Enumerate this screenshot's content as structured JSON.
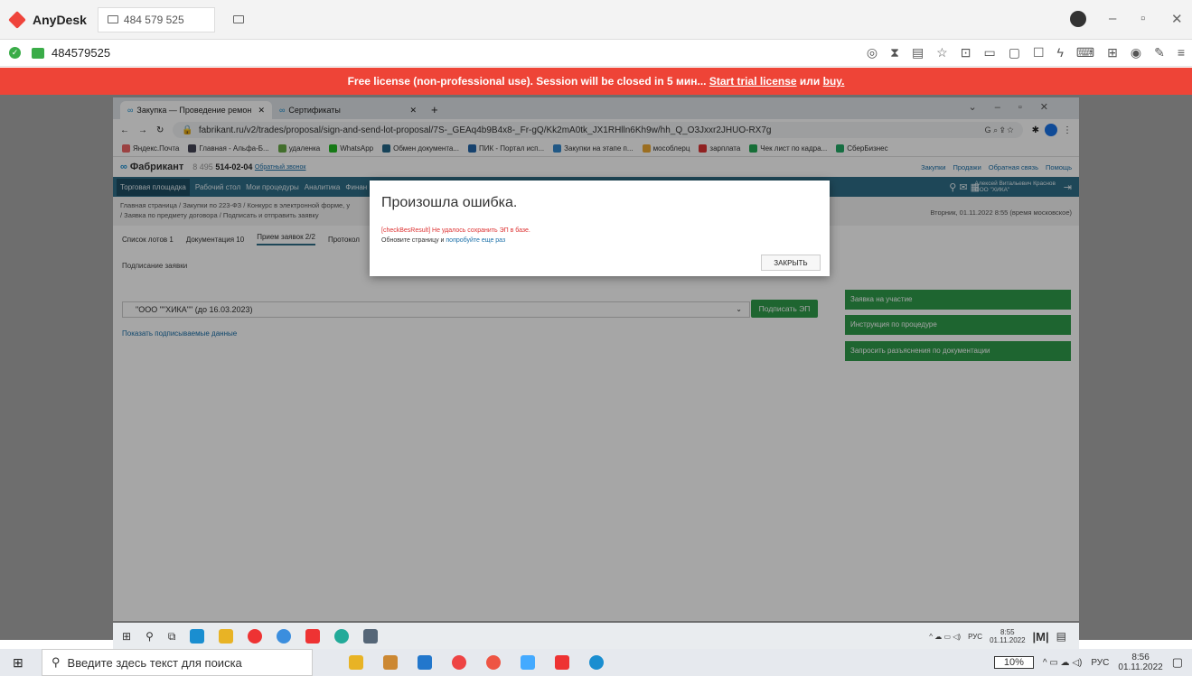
{
  "anydesk": {
    "app_name": "AnyDesk",
    "tab_id": "484 579 525",
    "session_id": "484579525",
    "colors": {
      "brand": "#ef443b",
      "ok": "#3aac48"
    }
  },
  "banner": {
    "text": "Free license (non-professional use). Session will be closed in 5 мин...",
    "link1": "Start trial license",
    "or": "или",
    "link2": "buy."
  },
  "browser": {
    "tabs": [
      {
        "label": "Закупка — Проведение ремон"
      },
      {
        "label": "Сертификаты"
      }
    ],
    "url": "fabrikant.ru/v2/trades/proposal/sign-and-send-lot-proposal/7S-_GEAq4b9B4x8-_Fr-gQ/Kk2mA0tk_JX1RHlln6Kh9w/hh_Q_O3Jxxr2JHUO-RX7g",
    "bookmarks": [
      "Яндекс.Почта",
      "Главная - Альфа-Б...",
      "удаленка",
      "WhatsApp",
      "Обмен документа...",
      "ПИК - Портал исп...",
      "Закупки на этапе п...",
      "мособлерц",
      "зарплата",
      "Чек лист по кадра...",
      "СберБизнес"
    ]
  },
  "site": {
    "logo": "Фабрикант",
    "phone_prefix": "8 495",
    "phone": "514-02-04",
    "callback": "Обратный звонок",
    "top_links": [
      "Закупки",
      "Продажи",
      "Обратная связь",
      "Помощь"
    ],
    "nav": [
      "Торговая площадка",
      "Рабочий стол",
      "Мои процедуры",
      "Аналитика",
      "Финан"
    ],
    "user_name": "Алексей Витальевич Краснов",
    "user_org": "ООО \"ХИКА\"",
    "breadcrumb1": "Главная страница / Закупки по 223-ФЗ / Конкурс в электронной форме, у",
    "breadcrumb2": "/ Заявка по предмету договора / Подписать и отправить заявку",
    "datetime": "Вторник, 01.11.2022 8:55 (время московское)",
    "tabs": [
      "Список лотов 1",
      "Документация 10",
      "Прием заявок 2/2",
      "Протокол"
    ],
    "sign_label": "Подписание заявки",
    "select_value": "\"ООО \"\"ХИКА\"\" (до 16.03.2023)",
    "sign_button": "Подписать ЭП",
    "show_data": "Показать подписываемые данные",
    "side_buttons": [
      "Заявка на участие",
      "Инструкция по процедуре",
      "Запросить разъяснения по документации"
    ]
  },
  "modal": {
    "title": "Произошла ошибка.",
    "error": "[checkBesResult] Не удалось сохранить ЭП в базе.",
    "hint_prefix": "Обновите страницу и ",
    "hint_link": "попробуйте еще раз",
    "close": "ЗАКРЫТЬ"
  },
  "inner_taskbar": {
    "lang": "РУС",
    "time": "8:55",
    "date": "01.11.2022"
  },
  "outer_taskbar": {
    "search_placeholder": "Введите здесь текст для поиска",
    "battery": "10%",
    "lang": "РУС",
    "time": "8:56",
    "date": "01.11.2022"
  }
}
